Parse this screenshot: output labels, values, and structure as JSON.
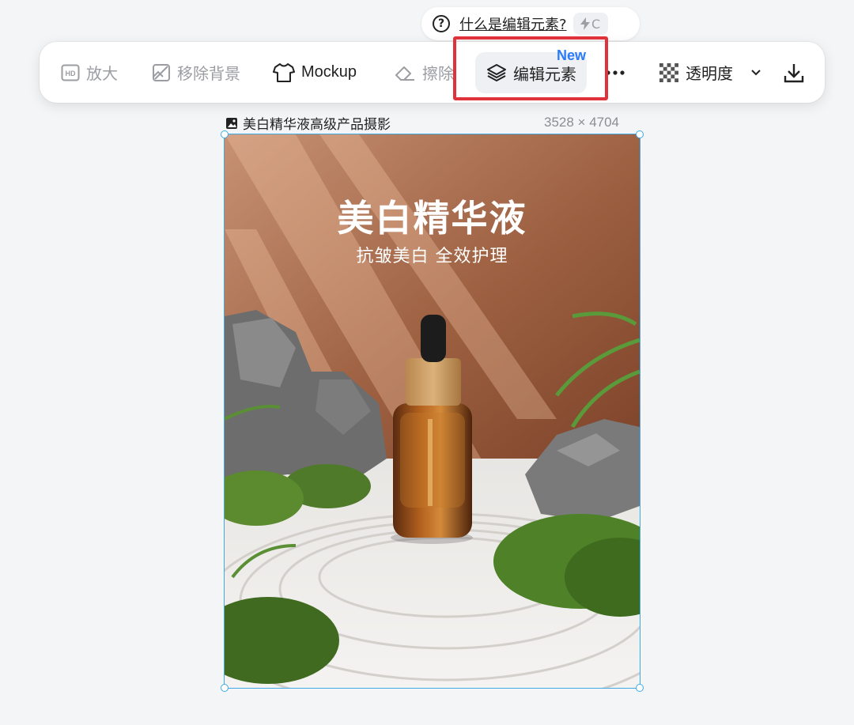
{
  "help": {
    "link_text": "什么是编辑元素?",
    "shortcut_key": "C",
    "shortcut_icon": "lightning-icon"
  },
  "toolbar": {
    "upscale_label": "放大",
    "remove_bg_label": "移除背景",
    "mockup_label": "Mockup",
    "erase_label": "擦除",
    "edit_elements_label": "编辑元素",
    "new_badge": "New",
    "more_icon": "more-dots-icon",
    "opacity_label": "透明度",
    "download_icon": "download-icon"
  },
  "image": {
    "title": "美白精华液高级产品摄影",
    "dimensions": "3528 × 4704",
    "headline": "美白精华液",
    "subheadline": "抗皱美白 全效护理"
  },
  "colors": {
    "accent_blue": "#2b7cf6",
    "highlight_red": "#e0323a",
    "selection_blue": "#3fa9e8"
  }
}
